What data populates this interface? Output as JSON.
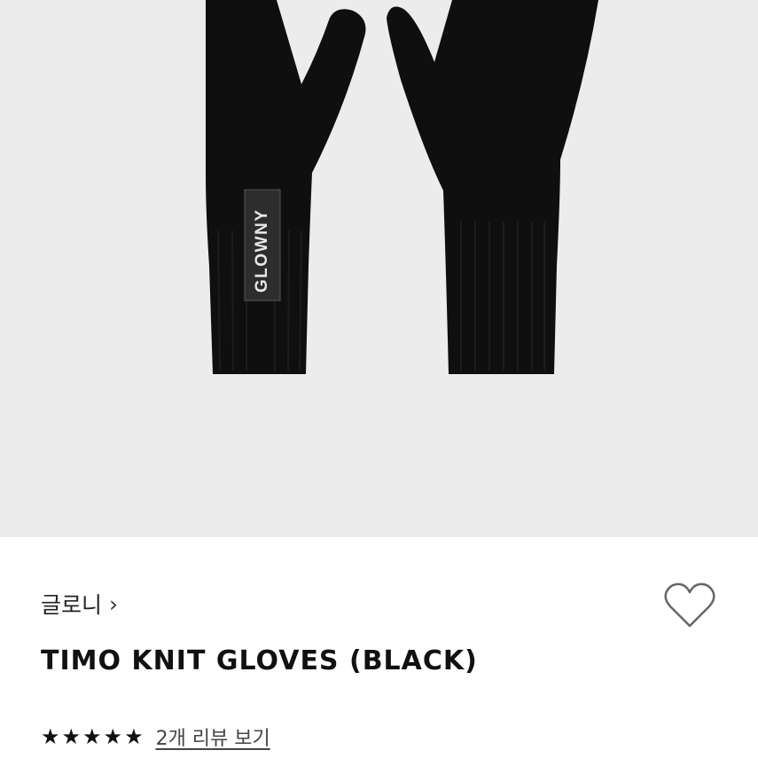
{
  "product": {
    "brand": "글로니",
    "title": "TIMO KNIT GLOVES (BLACK)",
    "image_label": "GLOWNY",
    "rating": 5,
    "rating_max": 5,
    "reviews_link": "2개 리뷰 보기"
  },
  "icons": {
    "brand_chevron": "chevron-right-icon",
    "wishlist": "heart-outline-icon",
    "star": "star-filled-icon"
  },
  "colors": {
    "image_background": "#ececec",
    "glove": "#0e0e0e",
    "text": "#111111"
  }
}
